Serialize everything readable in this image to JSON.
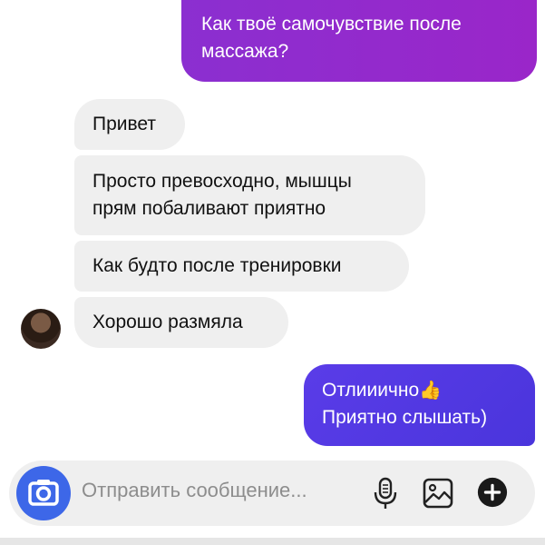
{
  "messages": [
    {
      "direction": "outgoing",
      "lines": [
        "Как твоё самочувствие после",
        "массажа?"
      ]
    },
    {
      "direction": "incoming",
      "lines": [
        "Привет"
      ]
    },
    {
      "direction": "incoming",
      "lines": [
        "Просто превосходно, мышцы",
        "прям побаливают приятно"
      ]
    },
    {
      "direction": "incoming",
      "lines": [
        "Как будто после тренировки"
      ]
    },
    {
      "direction": "incoming",
      "lines": [
        "Хорошо размяла"
      ]
    },
    {
      "direction": "outgoing",
      "lines": [
        "Отлииично",
        "Приятно слышать)"
      ],
      "emoji": "👍"
    }
  ],
  "composer": {
    "placeholder": "Отправить сообщение..."
  },
  "icons": {
    "camera": "camera-icon",
    "mic": "microphone-icon",
    "gallery": "gallery-icon",
    "add": "plus-icon",
    "avatar": "contact-avatar"
  },
  "colors": {
    "outgoing_top": "#9a26c9",
    "outgoing_bottom": "#4a35dc",
    "incoming": "#efefef",
    "camera_button": "#3d67e8"
  }
}
